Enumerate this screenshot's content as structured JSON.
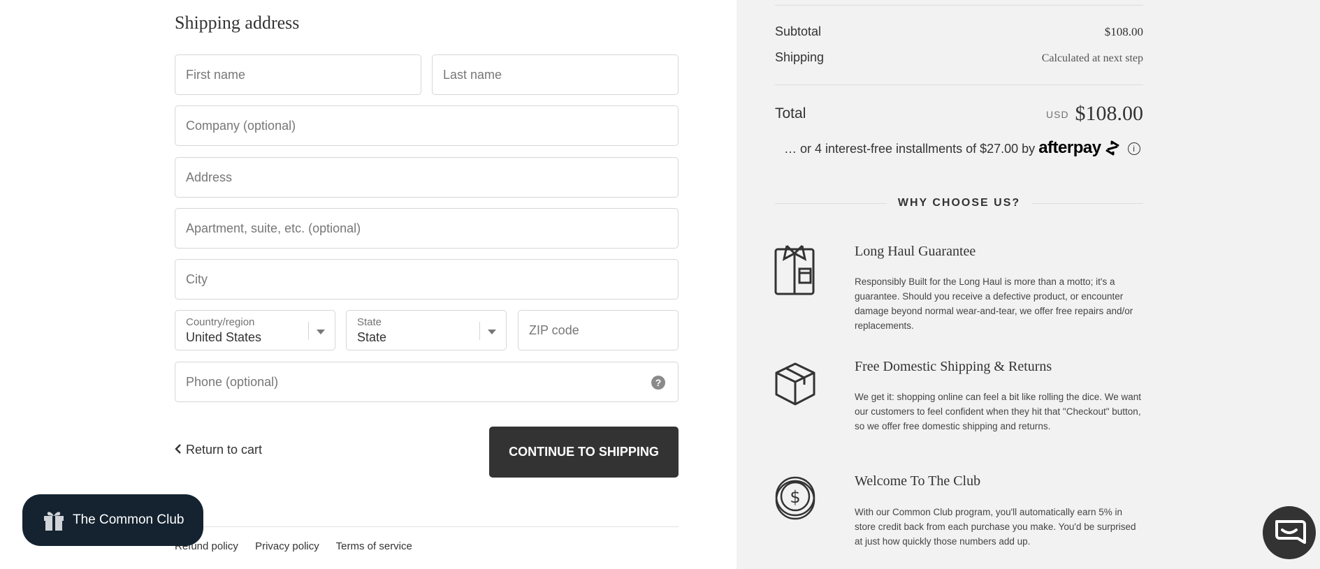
{
  "shipping": {
    "title": "Shipping address",
    "first_name_placeholder": "First name",
    "last_name_placeholder": "Last name",
    "company_placeholder": "Company (optional)",
    "address_placeholder": "Address",
    "apartment_placeholder": "Apartment, suite, etc. (optional)",
    "city_placeholder": "City",
    "country_label": "Country/region",
    "country_value": "United States",
    "state_label": "State",
    "state_value": "State",
    "zip_placeholder": "ZIP code",
    "phone_placeholder": "Phone (optional)",
    "help_glyph": "?",
    "return_label": "Return to cart",
    "continue_label": "CONTINUE TO SHIPPING"
  },
  "footer": {
    "links": [
      "Refund policy",
      "Privacy policy",
      "Terms of service"
    ]
  },
  "club_button": {
    "label": "The Common Club"
  },
  "summary": {
    "subtotal_label": "Subtotal",
    "subtotal_value": "$108.00",
    "shipping_label": "Shipping",
    "shipping_value": "Calculated at next step",
    "total_label": "Total",
    "currency": "USD",
    "total_value": "$108.00",
    "installments_text": "… or 4 interest-free installments of $27.00 by",
    "afterpay_brand": "afterpay",
    "info_glyph": "i"
  },
  "why": {
    "title": "WHY CHOOSE US?",
    "features": [
      {
        "icon": "shirt-icon",
        "title": "Long Haul Guarantee",
        "text": "Responsibly Built for the Long Haul is more than a motto; it's a guarantee. Should you receive a defective product, or encounter damage beyond normal wear-and-tear, we offer free repairs and/or replacements."
      },
      {
        "icon": "box-icon",
        "title": "Free Domestic Shipping & Returns",
        "text": "We get it: shopping online can feel a bit like rolling the dice. We want our customers to feel confident when they hit that \"Checkout\" button, so we offer free domestic shipping and returns."
      },
      {
        "icon": "coin-icon",
        "title": "Welcome To The Club",
        "text": "With our Common Club program, you'll automatically earn 5% in store credit back from each purchase you make. You'd be surprised at just how quickly those numbers add up."
      }
    ]
  },
  "colors": {
    "button_dark": "#333333",
    "club_bg": "#152330",
    "summary_bg": "#f2f2f2"
  }
}
